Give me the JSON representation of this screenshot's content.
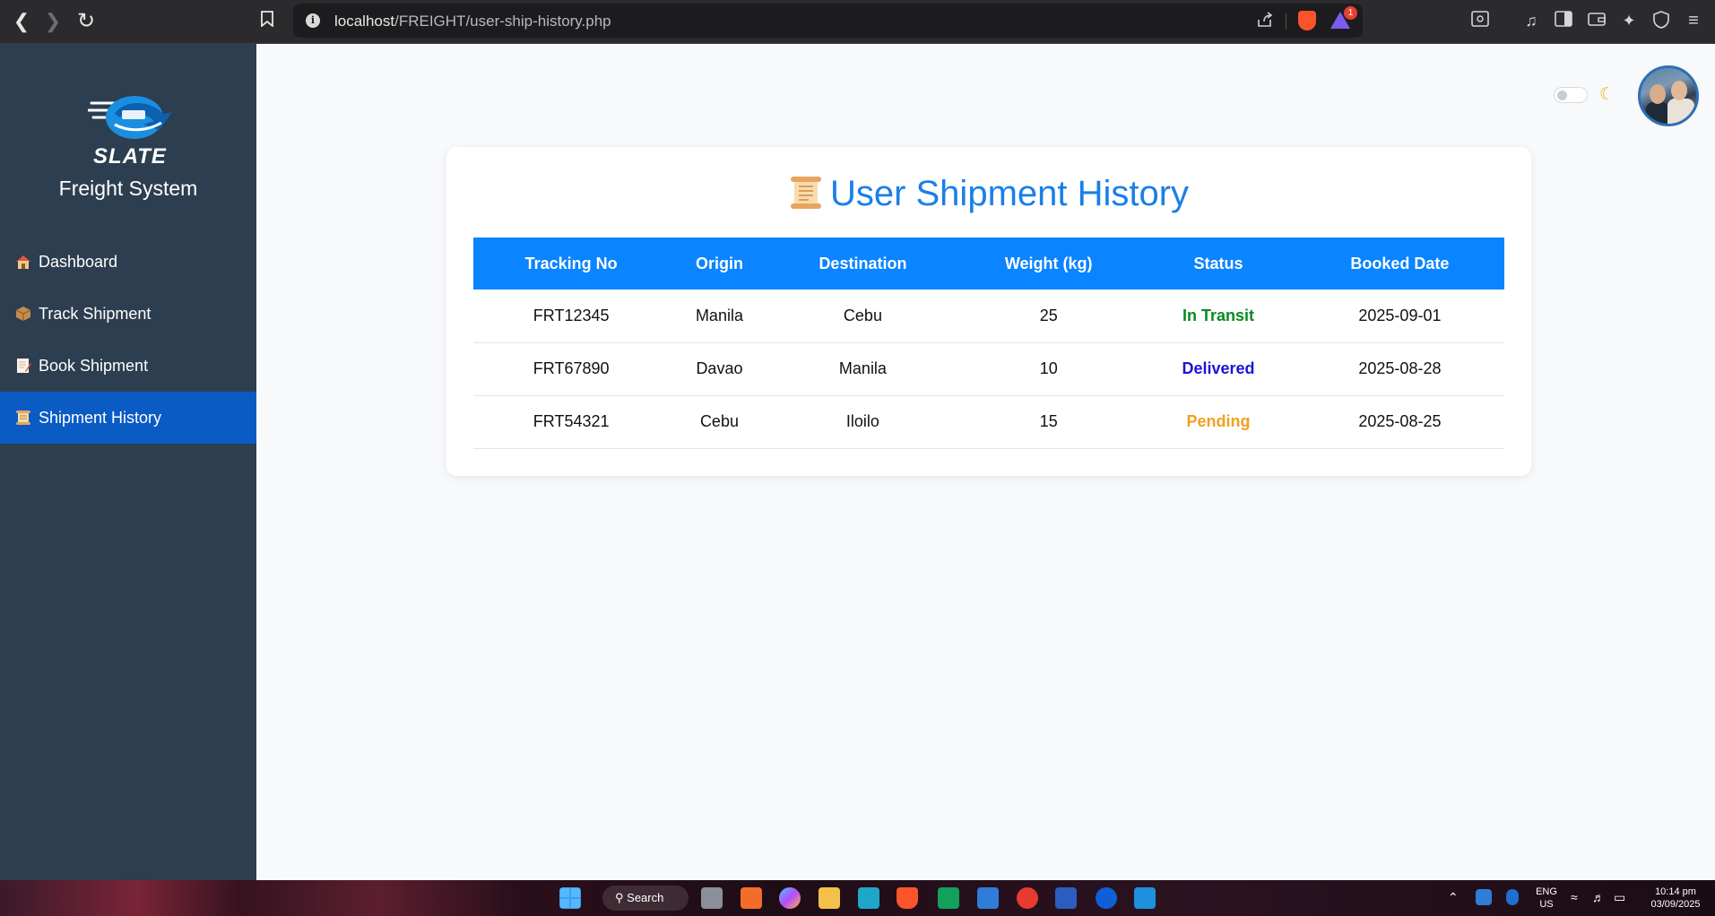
{
  "browser": {
    "url_host": "localhost",
    "url_path": "/FREIGHT/user-ship-history.php",
    "rewards_badge": "1"
  },
  "sidebar": {
    "logo_text": "SLATE",
    "system_title": "Freight System",
    "items": [
      {
        "label": "Dashboard",
        "icon": "house-icon"
      },
      {
        "label": "Track Shipment",
        "icon": "package-icon"
      },
      {
        "label": "Book Shipment",
        "icon": "memo-icon"
      },
      {
        "label": "Shipment History",
        "icon": "scroll-icon",
        "active": true
      }
    ]
  },
  "main": {
    "title": "User Shipment History",
    "columns": [
      "Tracking No",
      "Origin",
      "Destination",
      "Weight (kg)",
      "Status",
      "Booked Date"
    ],
    "rows": [
      {
        "tracking": "FRT12345",
        "origin": "Manila",
        "destination": "Cebu",
        "weight": "25",
        "status": "In Transit",
        "status_color": "#0a8a1f",
        "date": "2025-09-01"
      },
      {
        "tracking": "FRT67890",
        "origin": "Davao",
        "destination": "Manila",
        "weight": "10",
        "status": "Delivered",
        "status_color": "#1a14d8",
        "date": "2025-08-28"
      },
      {
        "tracking": "FRT54321",
        "origin": "Cebu",
        "destination": "Iloilo",
        "weight": "15",
        "status": "Pending",
        "status_color": "#f0a020",
        "date": "2025-08-25"
      }
    ]
  },
  "taskbar": {
    "search_label": "Search",
    "lang_1": "ENG",
    "lang_2": "US",
    "time": "10:14 pm",
    "date": "03/09/2025"
  },
  "colors": {
    "accent": "#0a84ff",
    "sidebar_bg": "#2c3e50",
    "sidebar_active": "#0a5bc4"
  }
}
